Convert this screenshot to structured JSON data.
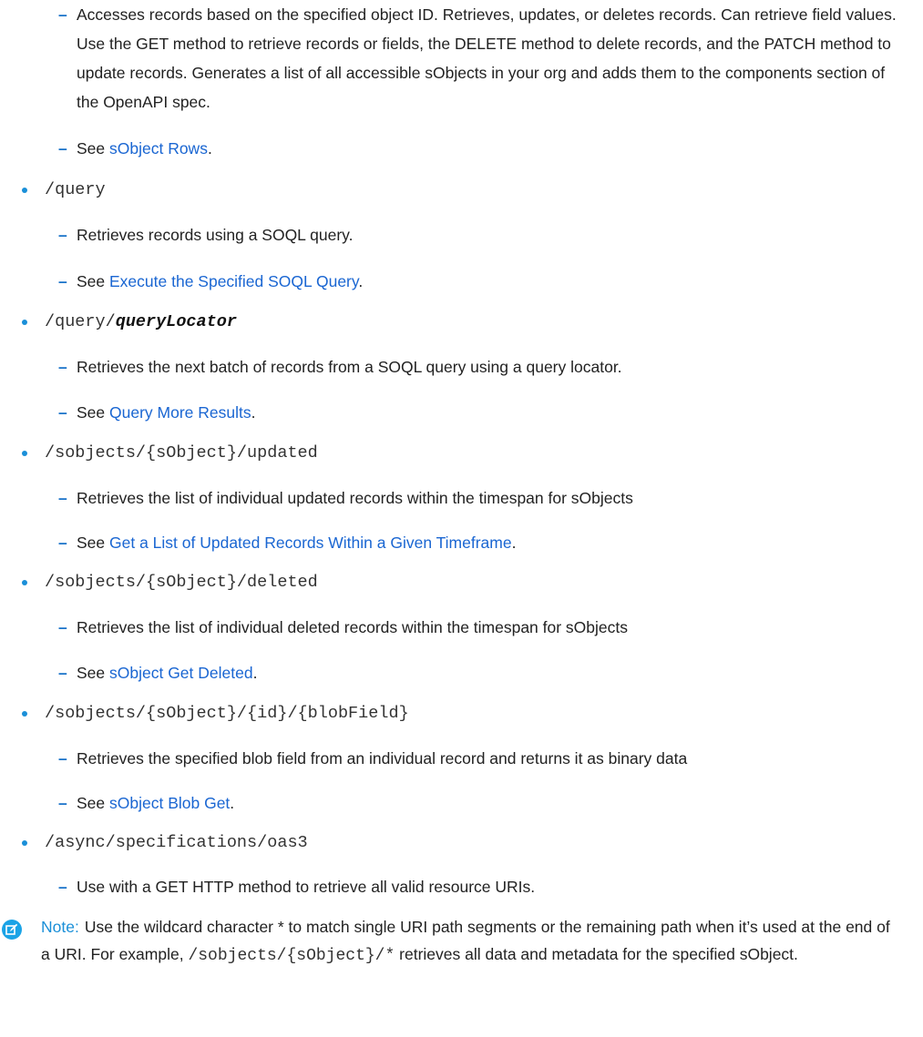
{
  "first_description": "Accesses records based on the specified object ID. Retrieves, updates, or deletes records. Can retrieve field values. Use the GET method to retrieve records or fields, the DELETE method to delete records, and the PATCH method to update records. Generates a list of all accessible sObjects in your org and adds them to the components section of the OpenAPI spec.",
  "first_see": {
    "prefix": "See ",
    "link": "sObject Rows",
    "suffix": "."
  },
  "items": [
    {
      "path": "/query",
      "description": "Retrieves records using a SOQL query.",
      "see": {
        "prefix": "See ",
        "link": "Execute the Specified SOQL Query",
        "suffix": "."
      }
    },
    {
      "path_prefix": "/query/",
      "path_param": "queryLocator",
      "description": "Retrieves the next batch of records from a SOQL query using a query locator.",
      "see": {
        "prefix": "See ",
        "link": "Query More Results",
        "suffix": "."
      }
    },
    {
      "path": "/sobjects/{sObject}/updated",
      "description": "Retrieves the list of individual updated records within the timespan for sObjects",
      "see": {
        "prefix": "See ",
        "link": "Get a List of Updated Records Within a Given Timeframe",
        "suffix": "."
      }
    },
    {
      "path": "/sobjects/{sObject}/deleted",
      "description": "Retrieves the list of individual deleted records within the timespan for sObjects",
      "see": {
        "prefix": "See ",
        "link": "sObject Get Deleted",
        "suffix": "."
      }
    },
    {
      "path": "/sobjects/{sObject}/{id}/{blobField}",
      "description": "Retrieves the specified blob field from an individual record and returns it as binary data",
      "see": {
        "prefix": "See ",
        "link": "sObject Blob Get",
        "suffix": "."
      }
    },
    {
      "path": "/async/specifications/oas3",
      "description": "Use with a GET HTTP method to retrieve all valid resource URIs."
    }
  ],
  "note": {
    "label": "Note:",
    "text_before": "Use the wildcard character * to match single URI path segments or the remaining path when it’s used at the end of a URI. For example, ",
    "code": "/sobjects/{sObject}/*",
    "text_after": " retrieves all data and metadata for the specified sObject."
  },
  "colors": {
    "link": "#1a66d2",
    "bullet": "#1a8fd8",
    "note_icon": "#1aa3e6"
  },
  "icons": {
    "bullet": "bullet-dot-icon",
    "dash": "dash-icon",
    "note": "edit-note-icon"
  }
}
